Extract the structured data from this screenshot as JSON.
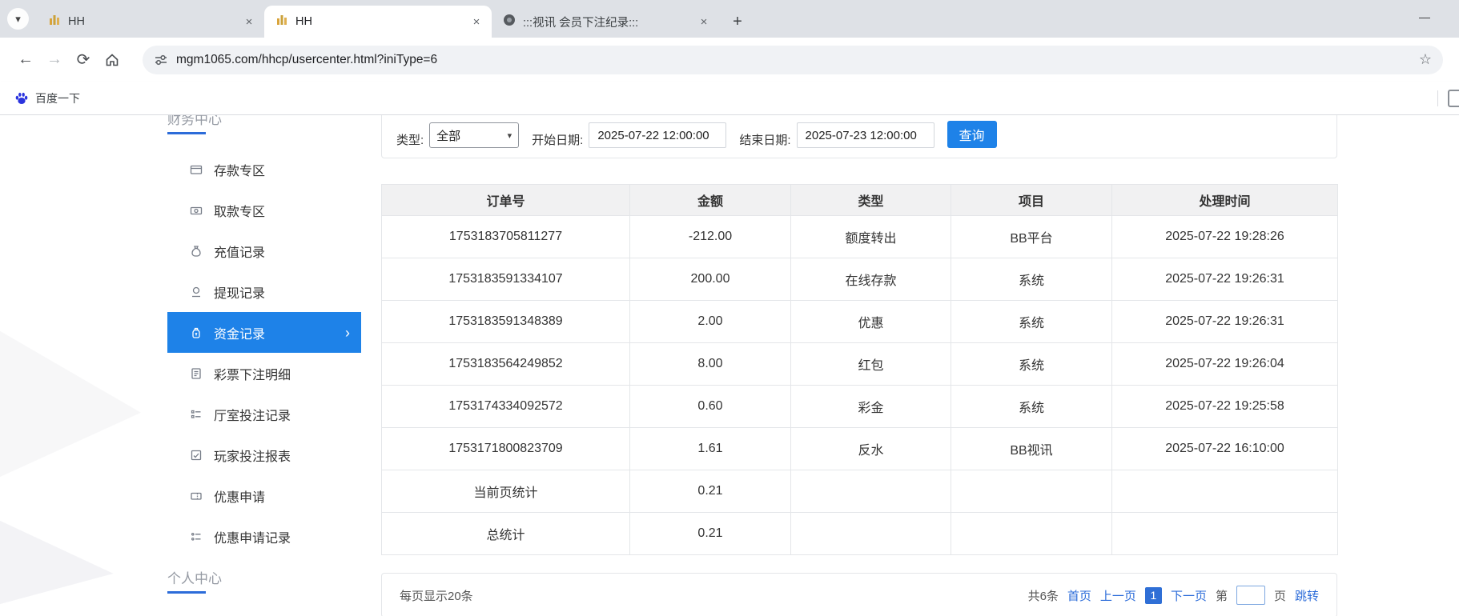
{
  "browser": {
    "tabs": [
      {
        "title": "HH"
      },
      {
        "title": "HH"
      },
      {
        "title": ":::视讯 会员下注纪录:::"
      }
    ],
    "url": "mgm1065.com/hhcp/usercenter.html?iniType=6",
    "bookmark_label": "百度一下"
  },
  "sidebar": {
    "top_section": "财务中心",
    "bottom_section": "个人中心",
    "items": [
      {
        "label": "存款专区"
      },
      {
        "label": "取款专区"
      },
      {
        "label": "充值记录"
      },
      {
        "label": "提现记录"
      },
      {
        "label": "资金记录"
      },
      {
        "label": "彩票下注明细"
      },
      {
        "label": "厅室投注记录"
      },
      {
        "label": "玩家投注报表"
      },
      {
        "label": "优惠申请"
      },
      {
        "label": "优惠申请记录"
      }
    ]
  },
  "filters": {
    "type_label": "类型:",
    "type_value": "全部",
    "start_label": "开始日期:",
    "start_value": "2025-07-22 12:00:00",
    "end_label": "结束日期:",
    "end_value": "2025-07-23 12:00:00",
    "query_button": "查询"
  },
  "table": {
    "headers": [
      "订单号",
      "金额",
      "类型",
      "项目",
      "处理时间"
    ],
    "rows": [
      [
        "1753183705811277",
        "-212.00",
        "额度转出",
        "BB平台",
        "2025-07-22 19:28:26"
      ],
      [
        "1753183591334107",
        "200.00",
        "在线存款",
        "系统",
        "2025-07-22 19:26:31"
      ],
      [
        "1753183591348389",
        "2.00",
        "优惠",
        "系统",
        "2025-07-22 19:26:31"
      ],
      [
        "1753183564249852",
        "8.00",
        "红包",
        "系统",
        "2025-07-22 19:26:04"
      ],
      [
        "1753174334092572",
        "0.60",
        "彩金",
        "系统",
        "2025-07-22 19:25:58"
      ],
      [
        "1753171800823709",
        "1.61",
        "反水",
        "BB视讯",
        "2025-07-22 16:10:00"
      ],
      [
        "当前页统计",
        "0.21",
        "",
        "",
        ""
      ],
      [
        "总统计",
        "0.21",
        "",
        "",
        ""
      ]
    ]
  },
  "pagination": {
    "page_size_text": "每页显示20条",
    "total_text": "共6条",
    "first": "首页",
    "prev": "上一页",
    "current": "1",
    "next": "下一页",
    "jump_pre": "第",
    "jump_value": "",
    "jump_post": "页",
    "jump_button": "跳转"
  },
  "colors": {
    "accent": "#1e82e8",
    "link": "#2c6cd9",
    "header-bg": "#f1f1f2",
    "border": "#e4e6e9"
  }
}
